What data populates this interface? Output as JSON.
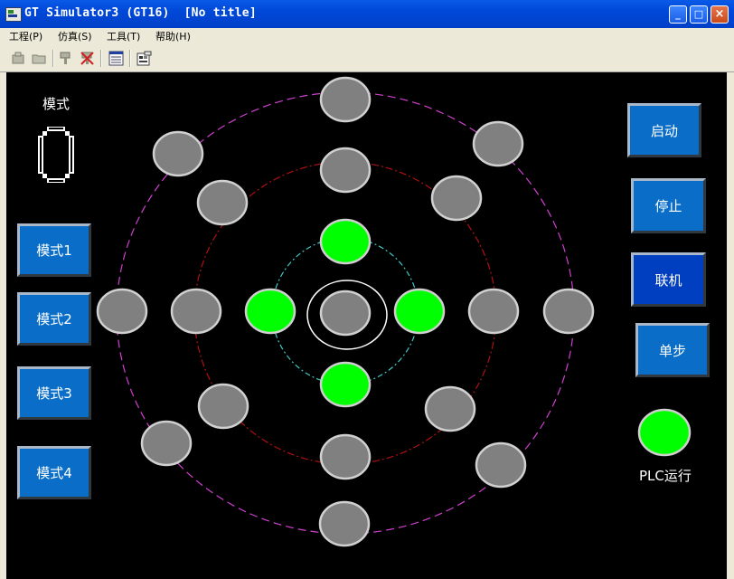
{
  "window": {
    "title": "GT Simulator3 (GT16)  [No title]"
  },
  "menu": [
    "工程(P)",
    "仿真(S)",
    "工具(T)",
    "帮助(H)"
  ],
  "toolbar": {
    "icons": [
      "open-project-icon",
      "open-folder-icon",
      "device-monitor-icon",
      "stop-monitor-icon",
      "list-icon",
      "properties-icon"
    ]
  },
  "panel": {
    "mode_label": "模式",
    "mode_value": "0",
    "mode_buttons": [
      "模式1",
      "模式2",
      "模式3",
      "模式4"
    ],
    "control_buttons": [
      "启动",
      "停止",
      "联机",
      "单步"
    ],
    "plc_label": "PLC运行"
  },
  "colors": {
    "lamp_on": "#00ff00",
    "lamp_off": "#808080",
    "button": "#0a6ec8",
    "button_active": "#003fc0"
  },
  "lamps": {
    "plc_run": "on",
    "inner_top": "on",
    "inner_left": "on",
    "inner_right": "on",
    "inner_bottom": "on",
    "center": "off"
  }
}
